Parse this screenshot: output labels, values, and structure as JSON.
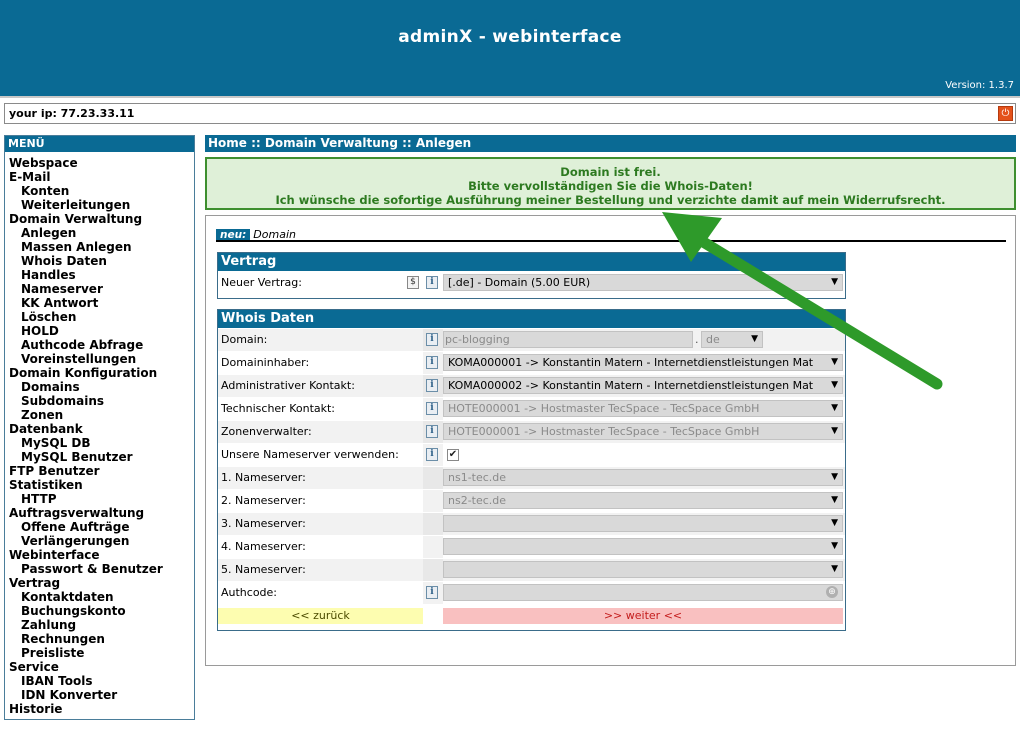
{
  "app": {
    "title": "adminX - webinterface",
    "version": "Version: 1.3.7"
  },
  "ipbar": {
    "text": "your ip: 77.23.33.11"
  },
  "menu": {
    "title": "MENÜ",
    "items": [
      {
        "label": "Webspace",
        "level": 1
      },
      {
        "label": "E-Mail",
        "level": 1
      },
      {
        "label": "Konten",
        "level": 2
      },
      {
        "label": "Weiterleitungen",
        "level": 2
      },
      {
        "label": "Domain Verwaltung",
        "level": 1
      },
      {
        "label": "Anlegen",
        "level": 2
      },
      {
        "label": "Massen Anlegen",
        "level": 2
      },
      {
        "label": "Whois Daten",
        "level": 2
      },
      {
        "label": "Handles",
        "level": 2
      },
      {
        "label": "Nameserver",
        "level": 2
      },
      {
        "label": "KK Antwort",
        "level": 2
      },
      {
        "label": "Löschen",
        "level": 2
      },
      {
        "label": "HOLD",
        "level": 2
      },
      {
        "label": "Authcode Abfrage",
        "level": 2
      },
      {
        "label": "Voreinstellungen",
        "level": 2
      },
      {
        "label": "Domain Konfiguration",
        "level": 1
      },
      {
        "label": "Domains",
        "level": 2
      },
      {
        "label": "Subdomains",
        "level": 2
      },
      {
        "label": "Zonen",
        "level": 2
      },
      {
        "label": "Datenbank",
        "level": 1
      },
      {
        "label": "MySQL DB",
        "level": 2
      },
      {
        "label": "MySQL Benutzer",
        "level": 2
      },
      {
        "label": "FTP Benutzer",
        "level": 1
      },
      {
        "label": "Statistiken",
        "level": 1
      },
      {
        "label": "HTTP",
        "level": 2
      },
      {
        "label": "Auftragsverwaltung",
        "level": 1
      },
      {
        "label": "Offene Aufträge",
        "level": 2
      },
      {
        "label": "Verlängerungen",
        "level": 2
      },
      {
        "label": "Webinterface",
        "level": 1
      },
      {
        "label": "Passwort & Benutzer",
        "level": 2
      },
      {
        "label": "Vertrag",
        "level": 1
      },
      {
        "label": "Kontaktdaten",
        "level": 2
      },
      {
        "label": "Buchungskonto",
        "level": 2
      },
      {
        "label": "Zahlung",
        "level": 2
      },
      {
        "label": "Rechnungen",
        "level": 2
      },
      {
        "label": "Preisliste",
        "level": 2
      },
      {
        "label": "Service",
        "level": 1
      },
      {
        "label": "IBAN Tools",
        "level": 2
      },
      {
        "label": "IDN Konverter",
        "level": 2
      },
      {
        "label": "Historie",
        "level": 1
      }
    ]
  },
  "breadcrumb": "Home :: Domain Verwaltung :: Anlegen",
  "notice": {
    "line1": "Domain ist frei.",
    "line2": "Bitte vervollständigen Sie die Whois-Daten!",
    "line3": "Ich wünsche die sofortige Ausführung meiner Bestellung und verzichte damit auf mein Widerrufsrecht."
  },
  "section": {
    "badge": "neu:",
    "label": "Domain"
  },
  "vertrag": {
    "title": "Vertrag",
    "label": "Neuer Vertrag:",
    "value": "[.de] - Domain (5.00 EUR)"
  },
  "whois": {
    "title": "Whois Daten",
    "domain_label": "Domain:",
    "domain_value": "pc-blogging",
    "tld_value": "de",
    "owner_label": "Domaininhaber:",
    "owner_value": "KOMA000001 -> Konstantin Matern - Internetdienstleistungen Mat",
    "admin_label": "Administrativer Kontakt:",
    "admin_value": "KOMA000002 -> Konstantin Matern - Internetdienstleistungen Mat",
    "tech_label": "Technischer Kontakt:",
    "tech_value": "HOTE000001 -> Hostmaster TecSpace - TecSpace GmbH",
    "zone_label": "Zonenverwalter:",
    "zone_value": "HOTE000001 -> Hostmaster TecSpace - TecSpace GmbH",
    "ns_use_label": "Unsere Nameserver verwenden:",
    "ns_use_checked": true,
    "ns1_label": "1. Nameserver:",
    "ns1_value": "ns1-tec.de",
    "ns2_label": "2. Nameserver:",
    "ns2_value": "ns2-tec.de",
    "ns3_label": "3. Nameserver:",
    "ns3_value": "",
    "ns4_label": "4. Nameserver:",
    "ns4_value": "",
    "ns5_label": "5. Nameserver:",
    "ns5_value": "",
    "authcode_label": "Authcode:",
    "authcode_value": ""
  },
  "buttons": {
    "back": "<< zurück",
    "next": ">> weiter <<"
  },
  "colors": {
    "header": "#0a6a94",
    "notice_bg": "#dff0d8",
    "notice_text": "#2d7a20",
    "arrow": "#2e9a2a",
    "back_bg": "#fdfdb0",
    "next_bg": "#f9c0c0"
  }
}
